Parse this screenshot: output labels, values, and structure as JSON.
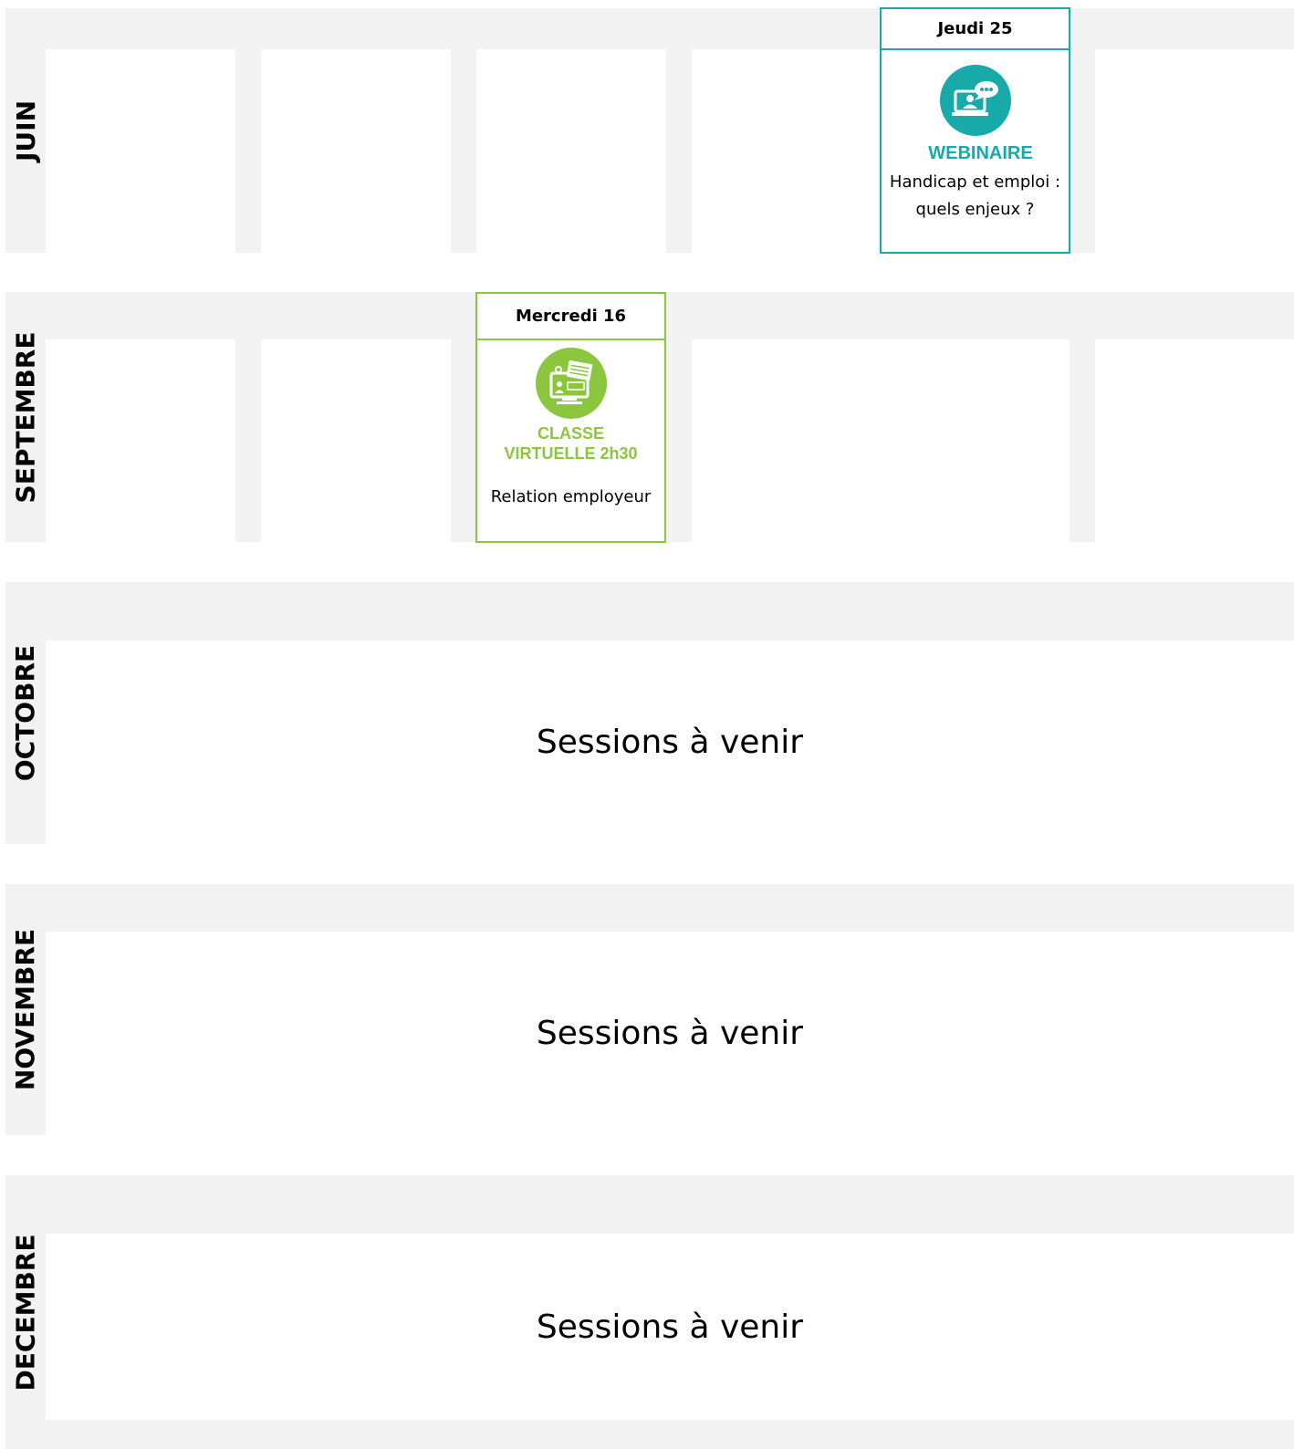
{
  "months": {
    "juin": "JUIN",
    "septembre": "SEPTEMBRE",
    "octobre": "OCTOBRE",
    "novembre": "NOVEMBRE",
    "decembre": "DECEMBRE"
  },
  "events": {
    "juin": {
      "date": "Jeudi 25",
      "type": "WEBINAIRE",
      "title_line1": "Handicap et emploi :",
      "title_line2": "quels enjeux ?",
      "icon": "webinar-icon",
      "color": "#17aaa8"
    },
    "septembre": {
      "date": "Mercredi 16",
      "type_line1": "CLASSE",
      "type_line2": "VIRTUELLE 2h30",
      "title": "Relation employeur",
      "icon": "virtual-class-icon",
      "color": "#8cc63f"
    }
  },
  "upcoming": {
    "octobre": "Sessions à venir",
    "novembre": "Sessions à venir",
    "decembre": "Sessions à venir"
  }
}
